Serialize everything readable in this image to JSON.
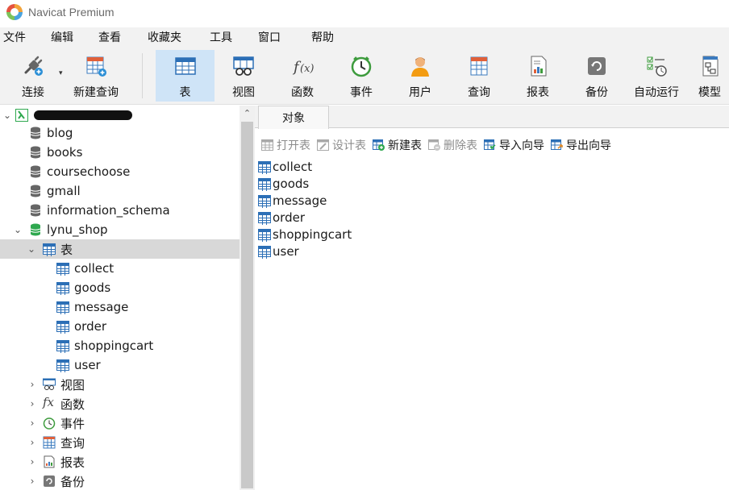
{
  "app": {
    "title": "Navicat Premium"
  },
  "menu": [
    "文件",
    "编辑",
    "查看",
    "收藏夹",
    "工具",
    "窗口",
    "帮助"
  ],
  "toolbar": {
    "items": [
      "连接",
      "新建查询",
      "表",
      "视图",
      "函数",
      "事件",
      "用户",
      "查询",
      "报表",
      "备份",
      "自动运行",
      "模型"
    ],
    "active": "表"
  },
  "sidebar": {
    "connection": "",
    "databases": [
      "blog",
      "books",
      "coursechoose",
      "gmall",
      "information_schema",
      "lynu_shop"
    ],
    "tables_group": "表",
    "tables": [
      "collect",
      "goods",
      "message",
      "order",
      "shoppingcart",
      "user"
    ],
    "other_groups": [
      "视图",
      "函数",
      "事件",
      "查询",
      "报表",
      "备份"
    ]
  },
  "main": {
    "tab": "对象",
    "actions": [
      {
        "label": "打开表",
        "enabled": false
      },
      {
        "label": "设计表",
        "enabled": false
      },
      {
        "label": "新建表",
        "enabled": true
      },
      {
        "label": "删除表",
        "enabled": false
      },
      {
        "label": "导入向导",
        "enabled": true
      },
      {
        "label": "导出向导",
        "enabled": true
      }
    ],
    "objects": [
      "collect",
      "goods",
      "message",
      "order",
      "shoppingcart",
      "user"
    ]
  },
  "colors": {
    "accent": "#2c6fb6",
    "selected_bg": "#cfe4f7",
    "tree_selected": "#d8d8d8",
    "db_active": "#2fa84f"
  }
}
